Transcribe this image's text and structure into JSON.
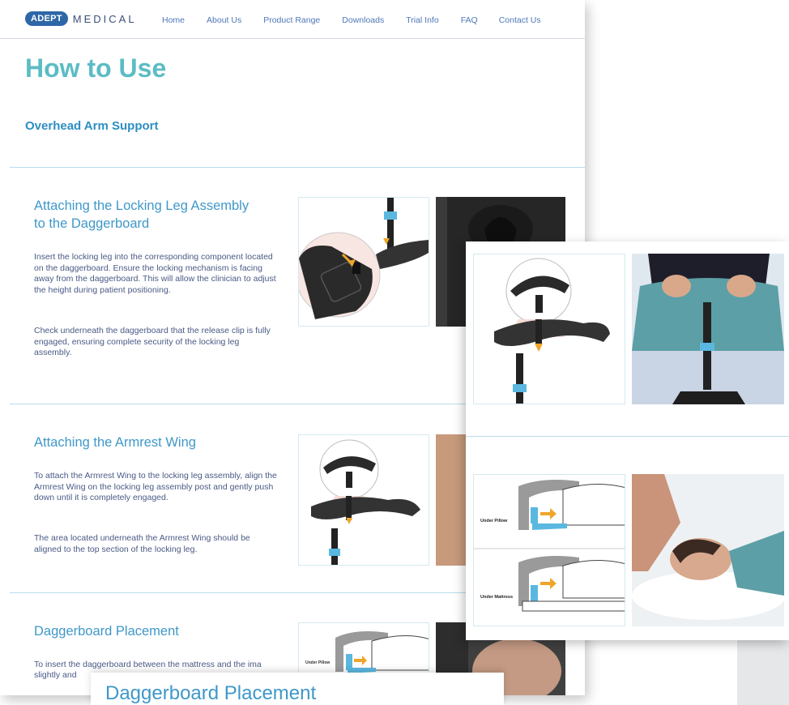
{
  "logo": {
    "badge": "ADEPT",
    "text": "MEDICAL"
  },
  "nav": [
    "Home",
    "About Us",
    "Product Range",
    "Downloads",
    "Trial Info",
    "FAQ",
    "Contact Us"
  ],
  "page": {
    "title": "How to Use",
    "subtitle": "Overhead Arm Support"
  },
  "sections": [
    {
      "title_line1": "Attaching the Locking Leg Assembly",
      "title_line2": "to the Daggerboard",
      "para1": "Insert the locking leg into the corresponding component located on the daggerboard. Ensure the locking mechanism is facing away from the daggerboard. This will allow the clinician to adjust the height during patient positioning.",
      "para2": "Check underneath the daggerboard that the release clip is fully engaged, ensuring complete security of the locking leg assembly."
    },
    {
      "title_line1": "Attaching the Armrest Wing",
      "para1": "To attach the Armrest Wing to the locking leg assembly, align the Armrest Wing on the locking leg assembly post and gently push down until it is completely engaged.",
      "para2": "The area located underneath the Armrest Wing should be aligned to the top section of the locking leg."
    },
    {
      "title_line1": "Daggerboard Placement",
      "para1": "To insert the daggerboard between the mattress and the ima",
      "para1_cont": "slightly and"
    }
  ],
  "diagram_labels": {
    "under_pillow": "Under Pillow",
    "under_mattress": "Under Mattress"
  },
  "bottom_banner": "Daggerboard Placement",
  "colors": {
    "accent": "#5bbcc4",
    "heading": "#3f98c9",
    "nav": "#4e78b8",
    "arrow": "#f0a52a",
    "clip": "#5ab8e0"
  }
}
